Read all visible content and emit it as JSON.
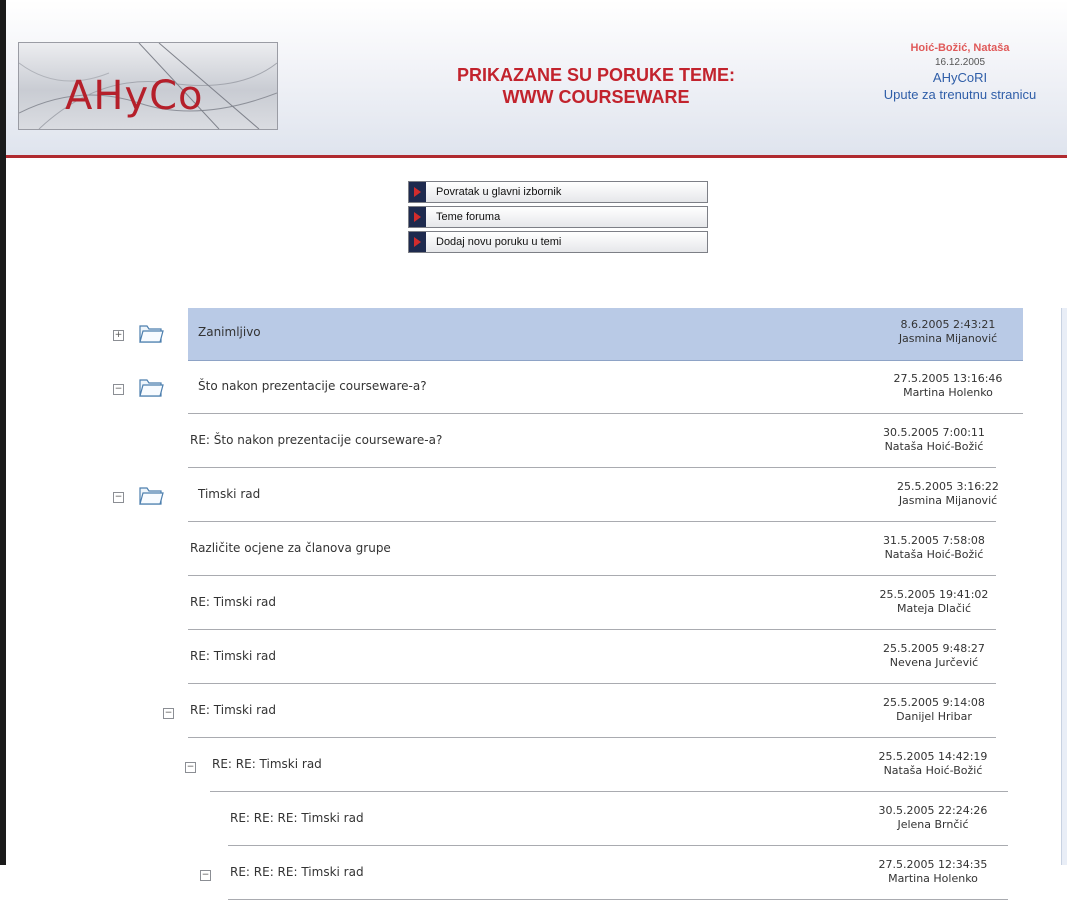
{
  "header": {
    "logo_text": "AHyCo",
    "title_line1": "PRIKAZANE SU PORUKE TEME:",
    "title_line2": "WWW COURSEWARE",
    "user_name": "Hoić-Božić, Nataša",
    "date": "16.12.2005",
    "app_link": "AHyCoRI",
    "help_link": "Upute za trenutnu stranicu"
  },
  "menu": [
    {
      "label": "Povratak u glavni izbornik"
    },
    {
      "label": "Teme foruma"
    },
    {
      "label": "Dodaj novu poruku u temi"
    }
  ],
  "icons": {
    "toggle_plus": "+",
    "toggle_minus": "−",
    "folder": "folder-icon",
    "menu_arrow": "arrow-right-icon"
  },
  "colors": {
    "brand_red": "#b51f2a",
    "title_red": "#c2232d",
    "selected_row": "#b9cae6",
    "link_blue": "#2f5ea8"
  },
  "messages": [
    {
      "subject": "Zanimljivo",
      "datetime": "8.6.2005 2:43:21",
      "author": "Jasmina Mijanović",
      "toggle": "+",
      "folder": true,
      "selected": true
    },
    {
      "subject": "Što nakon prezentacije courseware-a?",
      "datetime": "27.5.2005 13:16:46",
      "author": "Martina Holenko",
      "toggle": "−",
      "folder": true,
      "selected": false
    },
    {
      "subject": "RE: Što nakon prezentacije courseware-a?",
      "datetime": "30.5.2005 7:00:11",
      "author": "Nataša Hoić-Božić",
      "toggle": "",
      "folder": false,
      "selected": false
    },
    {
      "subject": "Timski rad",
      "datetime": "25.5.2005 3:16:22",
      "author": "Jasmina Mijanović",
      "toggle": "−",
      "folder": true,
      "selected": false
    },
    {
      "subject": "Različite ocjene za članova grupe",
      "datetime": "31.5.2005 7:58:08",
      "author": "Nataša Hoić-Božić",
      "toggle": "",
      "folder": false,
      "selected": false
    },
    {
      "subject": "RE: Timski rad",
      "datetime": "25.5.2005 19:41:02",
      "author": "Mateja Dlačić",
      "toggle": "",
      "folder": false,
      "selected": false
    },
    {
      "subject": "RE: Timski rad",
      "datetime": "25.5.2005 9:48:27",
      "author": "Nevena Jurčević",
      "toggle": "",
      "folder": false,
      "selected": false
    },
    {
      "subject": "RE: Timski rad",
      "datetime": "25.5.2005 9:14:08",
      "author": "Danijel Hribar",
      "toggle": "−",
      "folder": false,
      "selected": false
    },
    {
      "subject": "RE: RE: Timski rad",
      "datetime": "25.5.2005 14:42:19",
      "author": "Nataša Hoić-Božić",
      "toggle": "−",
      "folder": false,
      "selected": false
    },
    {
      "subject": "RE: RE: RE: Timski rad",
      "datetime": "30.5.2005 22:24:26",
      "author": "Jelena Brnčić",
      "toggle": "",
      "folder": false,
      "selected": false
    },
    {
      "subject": "RE: RE: RE: Timski rad",
      "datetime": "27.5.2005 12:34:35",
      "author": "Martina Holenko",
      "toggle": "−",
      "folder": false,
      "selected": false
    }
  ]
}
